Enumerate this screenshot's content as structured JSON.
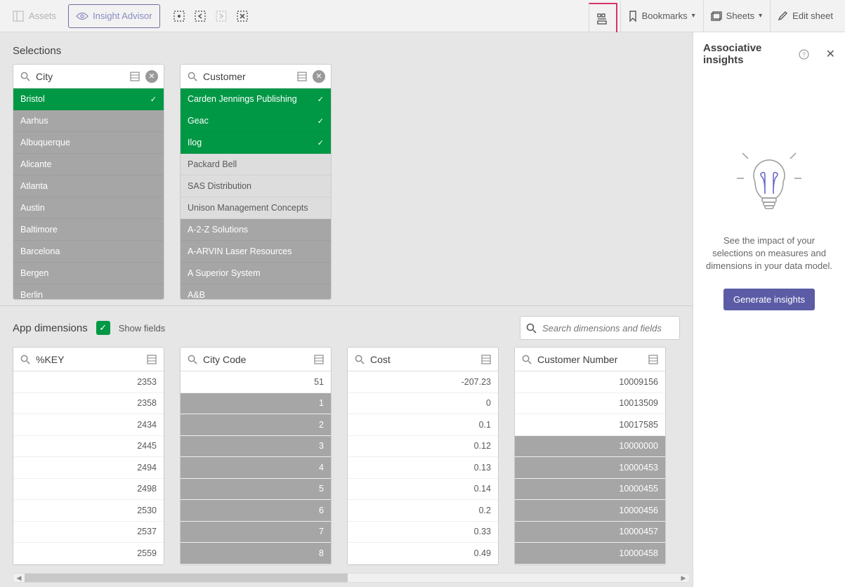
{
  "toolbar": {
    "assets": "Assets",
    "insight_advisor": "Insight Advisor",
    "bookmarks": "Bookmarks",
    "sheets": "Sheets",
    "edit_sheet": "Edit sheet"
  },
  "selections": {
    "title": "Selections",
    "cards": [
      {
        "title": "City",
        "items": [
          {
            "label": "Bristol",
            "state": "sel"
          },
          {
            "label": "Aarhus",
            "state": "alt1"
          },
          {
            "label": "Albuquerque",
            "state": "alt1"
          },
          {
            "label": "Alicante",
            "state": "alt1"
          },
          {
            "label": "Atlanta",
            "state": "alt1"
          },
          {
            "label": "Austin",
            "state": "alt1"
          },
          {
            "label": "Baltimore",
            "state": "alt1"
          },
          {
            "label": "Barcelona",
            "state": "alt1"
          },
          {
            "label": "Bergen",
            "state": "alt1"
          },
          {
            "label": "Berlin",
            "state": "alt1"
          }
        ]
      },
      {
        "title": "Customer",
        "items": [
          {
            "label": "Carden Jennings Publishing",
            "state": "sel"
          },
          {
            "label": "Geac",
            "state": "sel"
          },
          {
            "label": "Ilog",
            "state": "sel"
          },
          {
            "label": "Packard Bell",
            "state": "alt2"
          },
          {
            "label": "SAS Distribution",
            "state": "alt2"
          },
          {
            "label": "Unison Management Concepts",
            "state": "alt2"
          },
          {
            "label": "A-2-Z Solutions",
            "state": "alt3"
          },
          {
            "label": "A-ARVIN Laser Resources",
            "state": "alt3"
          },
          {
            "label": "A Superior System",
            "state": "alt3"
          },
          {
            "label": "A&B",
            "state": "alt3"
          }
        ]
      }
    ]
  },
  "app_dimensions": {
    "title": "App dimensions",
    "show_fields_label": "Show fields",
    "search_placeholder": "Search dimensions and fields",
    "cards": [
      {
        "title": "%KEY",
        "items": [
          {
            "v": "2353",
            "g": false
          },
          {
            "v": "2358",
            "g": false
          },
          {
            "v": "2434",
            "g": false
          },
          {
            "v": "2445",
            "g": false
          },
          {
            "v": "2494",
            "g": false
          },
          {
            "v": "2498",
            "g": false
          },
          {
            "v": "2530",
            "g": false
          },
          {
            "v": "2537",
            "g": false
          },
          {
            "v": "2559",
            "g": false
          }
        ]
      },
      {
        "title": "City Code",
        "items": [
          {
            "v": "51",
            "g": false
          },
          {
            "v": "1",
            "g": true
          },
          {
            "v": "2",
            "g": true
          },
          {
            "v": "3",
            "g": true
          },
          {
            "v": "4",
            "g": true
          },
          {
            "v": "5",
            "g": true
          },
          {
            "v": "6",
            "g": true
          },
          {
            "v": "7",
            "g": true
          },
          {
            "v": "8",
            "g": true
          }
        ]
      },
      {
        "title": "Cost",
        "items": [
          {
            "v": "-207.23",
            "g": false
          },
          {
            "v": "0",
            "g": false
          },
          {
            "v": "0.1",
            "g": false
          },
          {
            "v": "0.12",
            "g": false
          },
          {
            "v": "0.13",
            "g": false
          },
          {
            "v": "0.14",
            "g": false
          },
          {
            "v": "0.2",
            "g": false
          },
          {
            "v": "0.33",
            "g": false
          },
          {
            "v": "0.49",
            "g": false
          }
        ]
      },
      {
        "title": "Customer Number",
        "items": [
          {
            "v": "10009156",
            "g": false
          },
          {
            "v": "10013509",
            "g": false
          },
          {
            "v": "10017585",
            "g": false
          },
          {
            "v": "10000000",
            "g": true
          },
          {
            "v": "10000453",
            "g": true
          },
          {
            "v": "10000455",
            "g": true
          },
          {
            "v": "10000456",
            "g": true
          },
          {
            "v": "10000457",
            "g": true
          },
          {
            "v": "10000458",
            "g": true
          }
        ]
      }
    ]
  },
  "right_panel": {
    "title": "Associative insights",
    "description": "See the impact of your selections on measures and dimensions in your data model.",
    "button": "Generate insights"
  }
}
